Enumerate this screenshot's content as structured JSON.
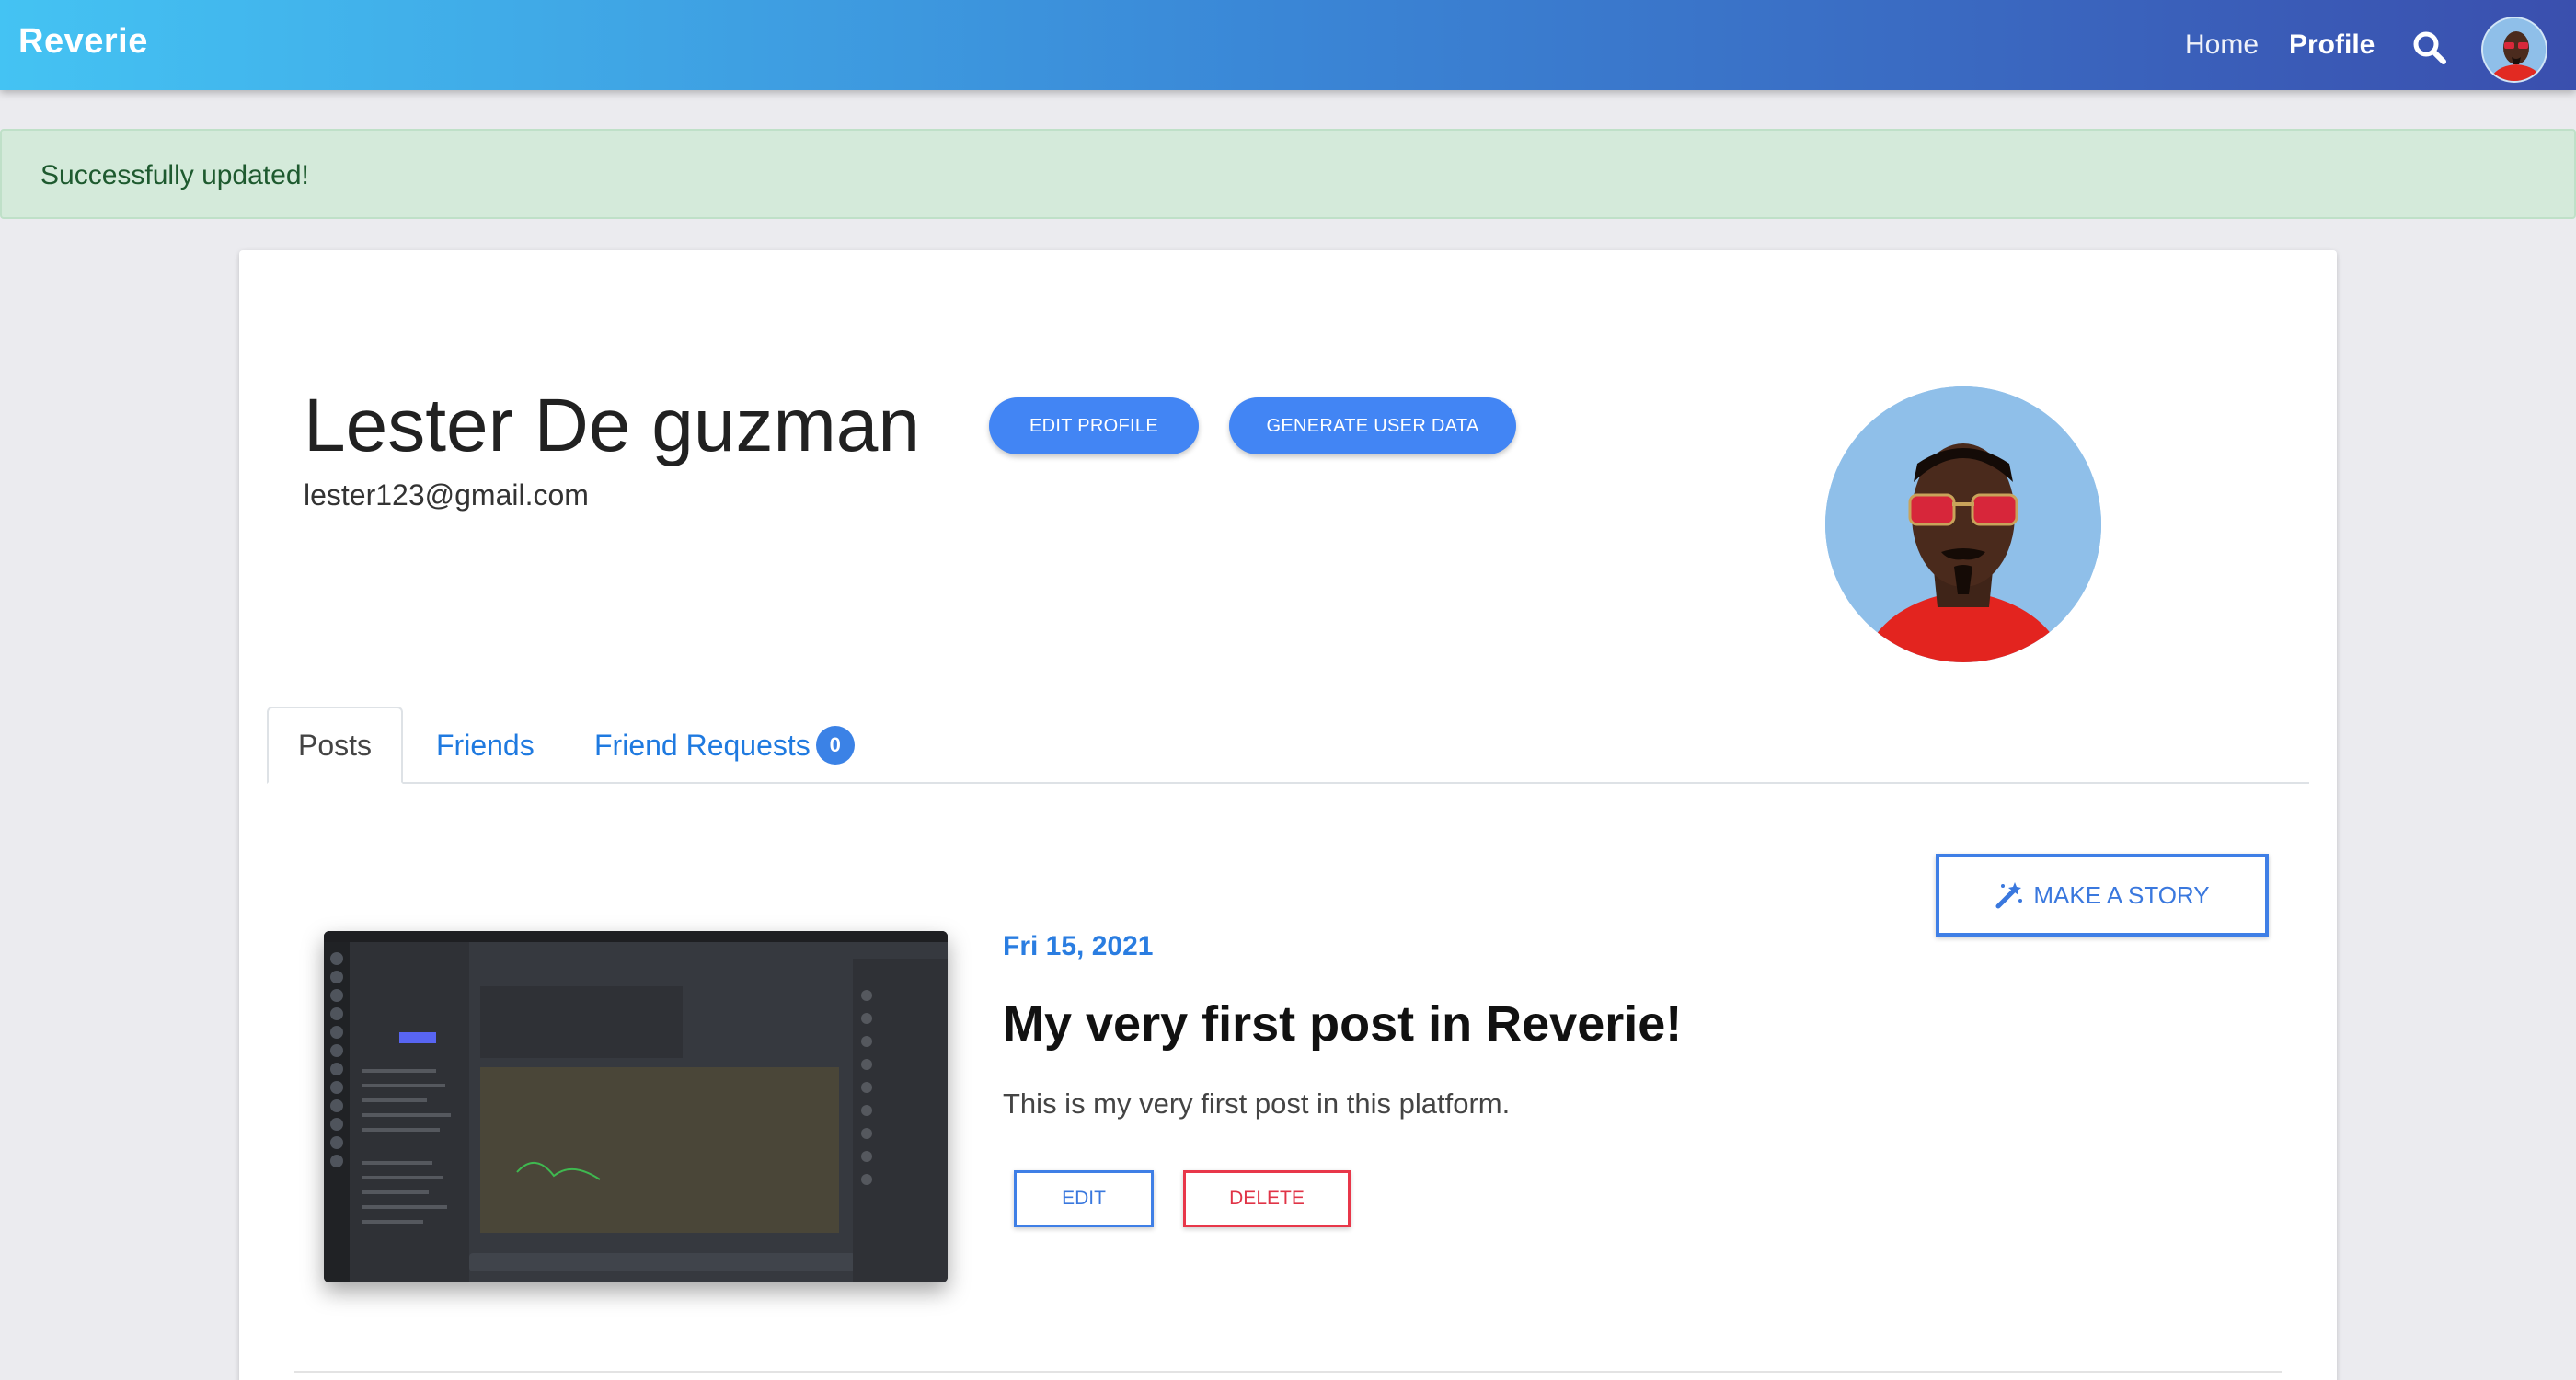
{
  "navbar": {
    "brand": "Reverie",
    "links": {
      "home": "Home",
      "profile": "Profile"
    },
    "icons": {
      "search": "search-icon",
      "avatar": "user-avatar"
    },
    "gradient": [
      "#44c3f3",
      "#3a4fae"
    ]
  },
  "alert": {
    "message": "Successfully updated!",
    "color": "#d4eada"
  },
  "profile": {
    "name": "Lester De guzman",
    "email": "lester123@gmail.com",
    "edit_profile_label": "EDIT PROFILE",
    "generate_label": "GENERATE USER DATA"
  },
  "tabs": {
    "posts": "Posts",
    "friends": "Friends",
    "friend_requests": "Friend Requests",
    "friend_requests_count": "0"
  },
  "story_button": {
    "label": "MAKE A STORY",
    "icon": "magic-wand-icon"
  },
  "post": {
    "date": "Fri 15, 2021",
    "title": "My very first post in Reverie!",
    "body": "This is my very first post in this platform.",
    "edit_label": "EDIT",
    "delete_label": "DELETE",
    "image": "discord-screenshot"
  },
  "colors": {
    "accent": "#4285f4",
    "danger": "#e8374a",
    "link": "#1f7ae0"
  }
}
